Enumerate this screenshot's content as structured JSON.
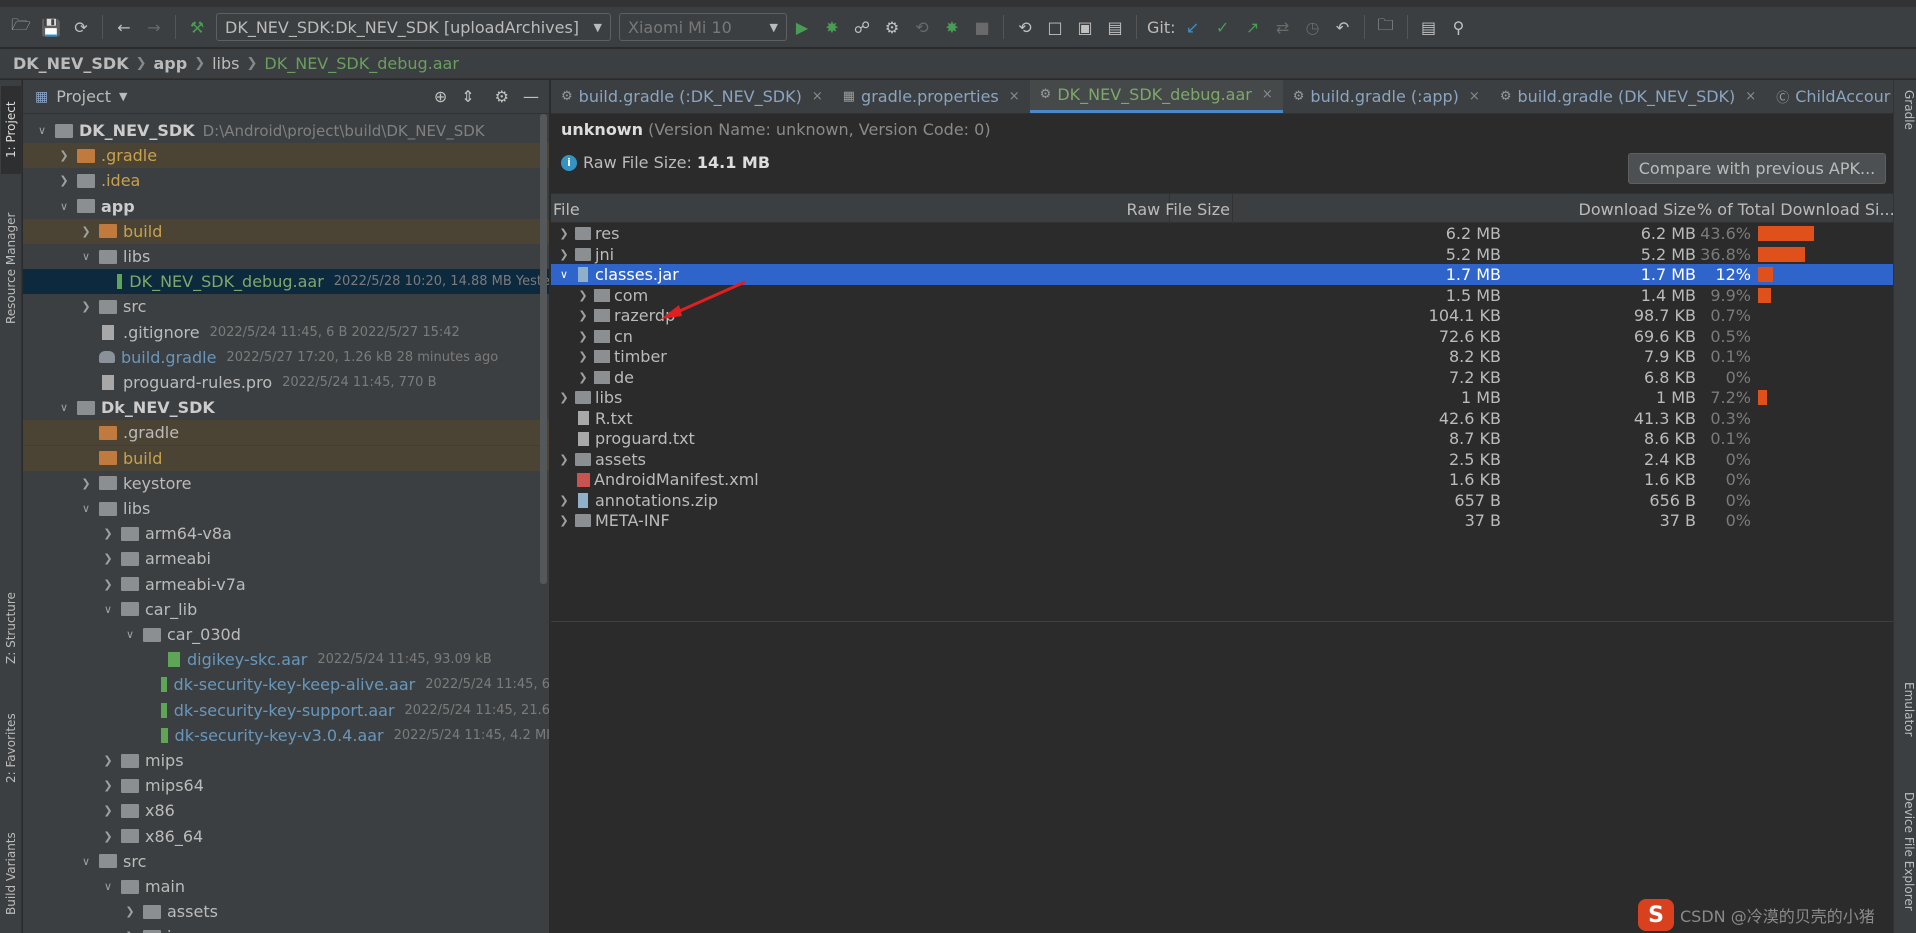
{
  "toolbar": {
    "run_config": "DK_NEV_SDK:Dk_NEV_SDK [uploadArchives]",
    "device": "Xiaomi Mi 10",
    "git_label": "Git:"
  },
  "breadcrumb": [
    "DK_NEV_SDK",
    "app",
    "libs",
    "DK_NEV_SDK_debug.aar"
  ],
  "left_strip": {
    "project": "1: Project",
    "resource_manager": "Resource Manager",
    "structure": "Z: Structure",
    "favorites": "2: Favorites",
    "build_variants": "Build Variants"
  },
  "right_strip": {
    "gradle": "Gradle",
    "emulator": "Emulator",
    "device_file": "Device File Explorer"
  },
  "project_panel": {
    "title": "Project",
    "tree": [
      {
        "label": "DK_NEV_SDK",
        "path": "D:\\Android\\project\\build\\DK_NEV_SDK",
        "meta": "",
        "depth": 0,
        "expand": "open",
        "icon": "module",
        "style": "bold",
        "row": ""
      },
      {
        "label": ".gradle",
        "path": "",
        "meta": "",
        "depth": 1,
        "expand": "closed",
        "icon": "folder-orange",
        "style": "orange",
        "row": "hl"
      },
      {
        "label": ".idea",
        "path": "",
        "meta": "",
        "depth": 1,
        "expand": "closed",
        "icon": "folder",
        "style": "orange",
        "row": ""
      },
      {
        "label": "app",
        "path": "",
        "meta": "",
        "depth": 1,
        "expand": "open",
        "icon": "module",
        "style": "bold",
        "row": ""
      },
      {
        "label": "build",
        "path": "",
        "meta": "",
        "depth": 2,
        "expand": "closed",
        "icon": "folder-orange",
        "style": "orange",
        "row": "hl"
      },
      {
        "label": "libs",
        "path": "",
        "meta": "",
        "depth": 2,
        "expand": "open",
        "icon": "folder",
        "style": "",
        "row": ""
      },
      {
        "label": "DK_NEV_SDK_debug.aar",
        "path": "",
        "meta": "2022/5/28 10:20, 14.88 MB Yeste",
        "depth": 3,
        "expand": "none",
        "icon": "aar",
        "style": "green",
        "row": "sel"
      },
      {
        "label": "src",
        "path": "",
        "meta": "",
        "depth": 2,
        "expand": "closed",
        "icon": "folder",
        "style": "",
        "row": ""
      },
      {
        "label": ".gitignore",
        "path": "",
        "meta": "2022/5/24 11:45, 6 B 2022/5/27 15:42",
        "depth": 2,
        "expand": "none",
        "icon": "file",
        "style": "",
        "row": ""
      },
      {
        "label": "build.gradle",
        "path": "",
        "meta": "2022/5/27 17:20, 1.26 kB 28 minutes ago",
        "depth": 2,
        "expand": "none",
        "icon": "gradle",
        "style": "blue",
        "row": ""
      },
      {
        "label": "proguard-rules.pro",
        "path": "",
        "meta": "2022/5/24 11:45, 770 B",
        "depth": 2,
        "expand": "none",
        "icon": "file",
        "style": "",
        "row": ""
      },
      {
        "label": "Dk_NEV_SDK",
        "path": "",
        "meta": "",
        "depth": 1,
        "expand": "open",
        "icon": "module",
        "style": "bold",
        "row": ""
      },
      {
        "label": ".gradle",
        "path": "",
        "meta": "",
        "depth": 2,
        "expand": "none",
        "icon": "folder-orange",
        "style": "",
        "row": "hl"
      },
      {
        "label": "build",
        "path": "",
        "meta": "",
        "depth": 2,
        "expand": "none",
        "icon": "folder-orange",
        "style": "orange",
        "row": "hl"
      },
      {
        "label": "keystore",
        "path": "",
        "meta": "",
        "depth": 2,
        "expand": "closed",
        "icon": "folder",
        "style": "",
        "row": ""
      },
      {
        "label": "libs",
        "path": "",
        "meta": "",
        "depth": 2,
        "expand": "open",
        "icon": "folder",
        "style": "",
        "row": ""
      },
      {
        "label": "arm64-v8a",
        "path": "",
        "meta": "",
        "depth": 3,
        "expand": "closed",
        "icon": "folder",
        "style": "",
        "row": ""
      },
      {
        "label": "armeabi",
        "path": "",
        "meta": "",
        "depth": 3,
        "expand": "closed",
        "icon": "folder",
        "style": "",
        "row": ""
      },
      {
        "label": "armeabi-v7a",
        "path": "",
        "meta": "",
        "depth": 3,
        "expand": "closed",
        "icon": "folder",
        "style": "",
        "row": ""
      },
      {
        "label": "car_lib",
        "path": "",
        "meta": "",
        "depth": 3,
        "expand": "open",
        "icon": "folder",
        "style": "",
        "row": ""
      },
      {
        "label": "car_030d",
        "path": "",
        "meta": "",
        "depth": 4,
        "expand": "open",
        "icon": "folder",
        "style": "",
        "row": ""
      },
      {
        "label": "digikey-skc.aar",
        "path": "",
        "meta": "2022/5/24 11:45, 93.09 kB",
        "depth": 5,
        "expand": "none",
        "icon": "aar",
        "style": "blue",
        "row": ""
      },
      {
        "label": "dk-security-key-keep-alive.aar",
        "path": "",
        "meta": "2022/5/24 11:45, 6",
        "depth": 5,
        "expand": "none",
        "icon": "aar",
        "style": "blue",
        "row": ""
      },
      {
        "label": "dk-security-key-support.aar",
        "path": "",
        "meta": "2022/5/24 11:45, 21.6",
        "depth": 5,
        "expand": "none",
        "icon": "aar",
        "style": "blue",
        "row": ""
      },
      {
        "label": "dk-security-key-v3.0.4.aar",
        "path": "",
        "meta": "2022/5/24 11:45, 4.2 MI",
        "depth": 5,
        "expand": "none",
        "icon": "aar",
        "style": "blue",
        "row": ""
      },
      {
        "label": "mips",
        "path": "",
        "meta": "",
        "depth": 3,
        "expand": "closed",
        "icon": "folder",
        "style": "",
        "row": ""
      },
      {
        "label": "mips64",
        "path": "",
        "meta": "",
        "depth": 3,
        "expand": "closed",
        "icon": "folder",
        "style": "",
        "row": ""
      },
      {
        "label": "x86",
        "path": "",
        "meta": "",
        "depth": 3,
        "expand": "closed",
        "icon": "folder",
        "style": "",
        "row": ""
      },
      {
        "label": "x86_64",
        "path": "",
        "meta": "",
        "depth": 3,
        "expand": "closed",
        "icon": "folder",
        "style": "",
        "row": ""
      },
      {
        "label": "src",
        "path": "",
        "meta": "",
        "depth": 2,
        "expand": "open",
        "icon": "folder",
        "style": "",
        "row": ""
      },
      {
        "label": "main",
        "path": "",
        "meta": "",
        "depth": 3,
        "expand": "open",
        "icon": "folder",
        "style": "",
        "row": ""
      },
      {
        "label": "assets",
        "path": "",
        "meta": "",
        "depth": 4,
        "expand": "closed",
        "icon": "folder",
        "style": "",
        "row": ""
      },
      {
        "label": "java",
        "path": "",
        "meta": "",
        "depth": 4,
        "expand": "closed",
        "icon": "folder",
        "style": "",
        "row": ""
      }
    ]
  },
  "tabs": [
    {
      "label": "build.gradle (:DK_NEV_SDK)",
      "active": false
    },
    {
      "label": "gradle.properties",
      "active": false
    },
    {
      "label": "DK_NEV_SDK_debug.aar",
      "active": true
    },
    {
      "label": "build.gradle (:app)",
      "active": false
    },
    {
      "label": "build.gradle (DK_NEV_SDK)",
      "active": false
    },
    {
      "label": "ChildAccour",
      "active": false
    }
  ],
  "analyzer": {
    "app_id": "unknown",
    "version_text": "(Version Name: unknown, Version Code: 0)",
    "raw_size_label": "Raw File Size:",
    "raw_size_value": "14.1 MB",
    "compare_button": "Compare with previous APK...",
    "columns": {
      "file": "File",
      "raw": "Raw File Size",
      "download": "Download Size",
      "percent": "% of Total Download Si..."
    },
    "rows": [
      {
        "name": "res",
        "depth": 0,
        "expand": "closed",
        "icon": "folder",
        "raw": "6.2 MB",
        "download": "6.2 MB",
        "percent": "43.6%",
        "share": 43.6,
        "selected": false
      },
      {
        "name": "jni",
        "depth": 0,
        "expand": "closed",
        "icon": "folder",
        "raw": "5.2 MB",
        "download": "5.2 MB",
        "percent": "36.8%",
        "share": 36.8,
        "selected": false
      },
      {
        "name": "classes.jar",
        "depth": 0,
        "expand": "open",
        "icon": "jar",
        "raw": "1.7 MB",
        "download": "1.7 MB",
        "percent": "12%",
        "share": 12,
        "selected": true
      },
      {
        "name": "com",
        "depth": 1,
        "expand": "closed",
        "icon": "pkg",
        "raw": "1.5 MB",
        "download": "1.4 MB",
        "percent": "9.9%",
        "share": 9.9,
        "selected": false
      },
      {
        "name": "razerdp",
        "depth": 1,
        "expand": "closed",
        "icon": "pkg",
        "raw": "104.1 KB",
        "download": "98.7 KB",
        "percent": "0.7%",
        "share": 0.7,
        "selected": false
      },
      {
        "name": "cn",
        "depth": 1,
        "expand": "closed",
        "icon": "pkg",
        "raw": "72.6 KB",
        "download": "69.6 KB",
        "percent": "0.5%",
        "share": 0.5,
        "selected": false
      },
      {
        "name": "timber",
        "depth": 1,
        "expand": "closed",
        "icon": "pkg",
        "raw": "8.2 KB",
        "download": "7.9 KB",
        "percent": "0.1%",
        "share": 0.1,
        "selected": false
      },
      {
        "name": "de",
        "depth": 1,
        "expand": "closed",
        "icon": "pkg",
        "raw": "7.2 KB",
        "download": "6.8 KB",
        "percent": "0%",
        "share": 0,
        "selected": false
      },
      {
        "name": "libs",
        "depth": 0,
        "expand": "closed",
        "icon": "folder",
        "raw": "1 MB",
        "download": "1 MB",
        "percent": "7.2%",
        "share": 7.2,
        "selected": false
      },
      {
        "name": "R.txt",
        "depth": 0,
        "expand": "none",
        "icon": "file",
        "raw": "42.6 KB",
        "download": "41.3 KB",
        "percent": "0.3%",
        "share": 0.3,
        "selected": false
      },
      {
        "name": "proguard.txt",
        "depth": 0,
        "expand": "none",
        "icon": "file",
        "raw": "8.7 KB",
        "download": "8.6 KB",
        "percent": "0.1%",
        "share": 0.1,
        "selected": false
      },
      {
        "name": "assets",
        "depth": 0,
        "expand": "closed",
        "icon": "folder",
        "raw": "2.5 KB",
        "download": "2.4 KB",
        "percent": "0%",
        "share": 0,
        "selected": false
      },
      {
        "name": "AndroidManifest.xml",
        "depth": 0,
        "expand": "none",
        "icon": "xml",
        "raw": "1.6 KB",
        "download": "1.6 KB",
        "percent": "0%",
        "share": 0,
        "selected": false
      },
      {
        "name": "annotations.zip",
        "depth": 0,
        "expand": "closed",
        "icon": "jar",
        "raw": "657 B",
        "download": "656 B",
        "percent": "0%",
        "share": 0,
        "selected": false
      },
      {
        "name": "META-INF",
        "depth": 0,
        "expand": "closed",
        "icon": "folder",
        "raw": "37 B",
        "download": "37 B",
        "percent": "0%",
        "share": 0,
        "selected": false
      }
    ]
  },
  "watermark": "CSDN @冷漠的贝壳的小猪",
  "colors": {
    "bar": "#e0501a",
    "selection": "#2f65ca",
    "arrow": "#e02020"
  }
}
